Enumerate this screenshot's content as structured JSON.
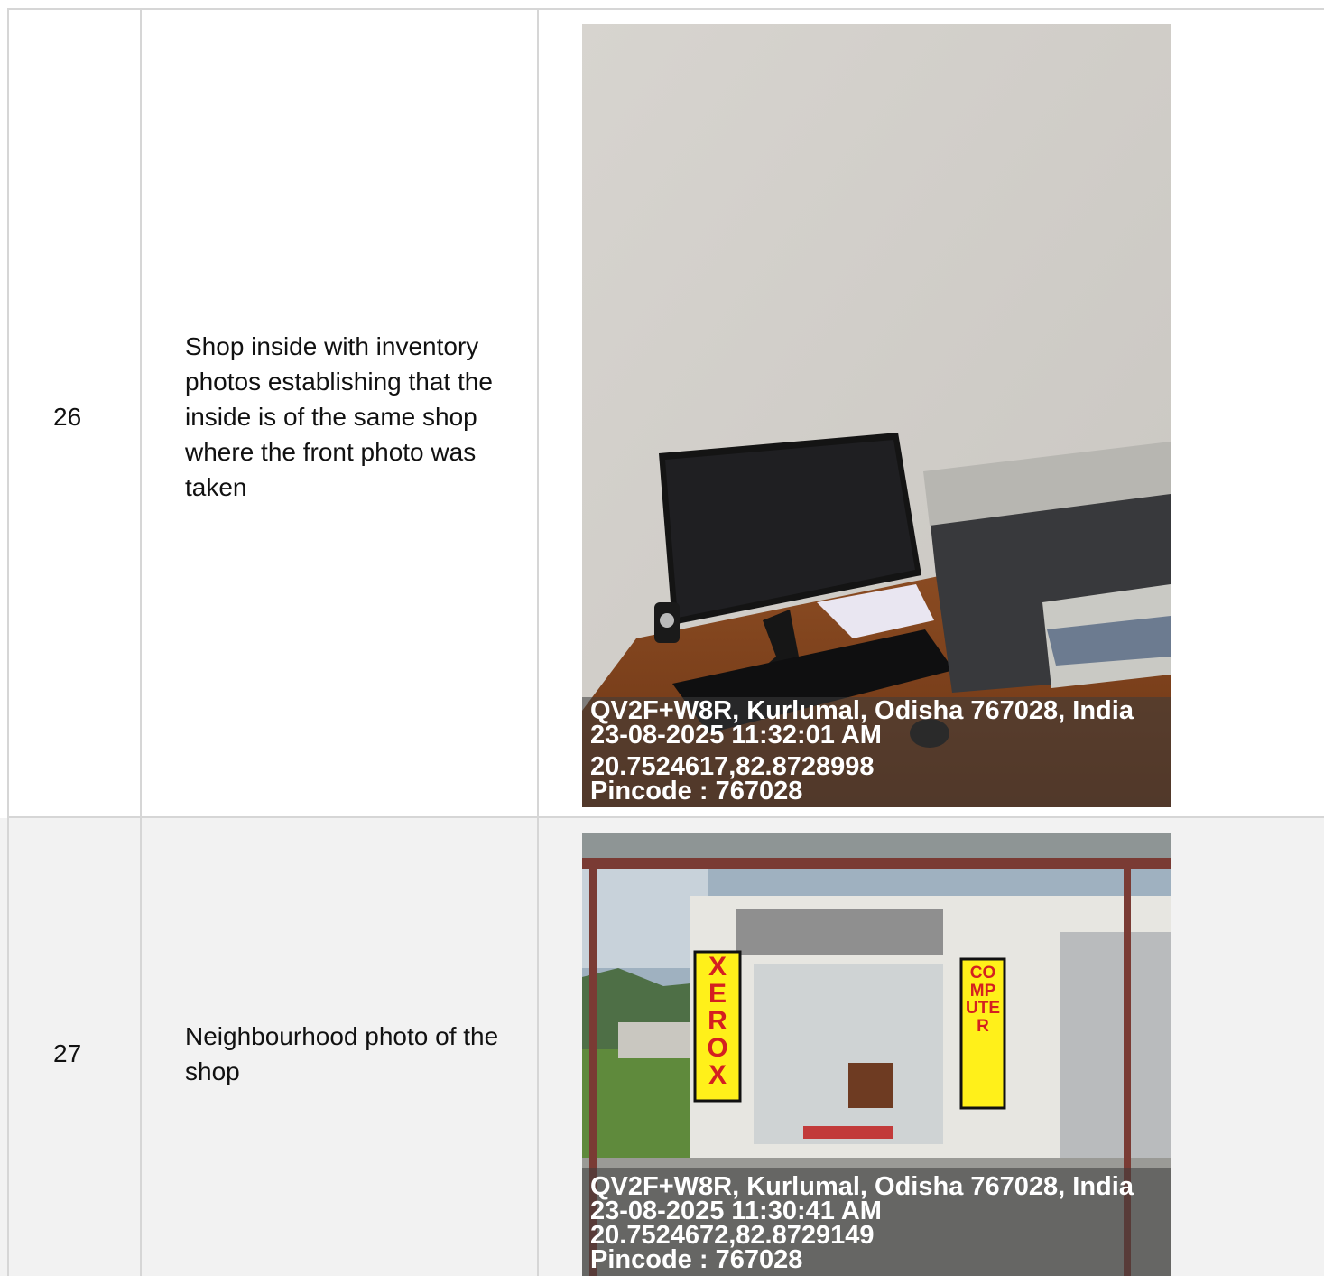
{
  "rows": [
    {
      "index": "26",
      "description": "Shop inside with inventory photos establishing that the inside is of the same shop where the front photo was taken",
      "photo": {
        "subject": "office-desk-monitor-printer",
        "overlay": {
          "address": "QV2F+W8R, Kurlumal, Odisha 767028, India",
          "datetime": "23-08-2025 11:32:01 AM",
          "coords": "20.7524617,82.8728998",
          "pincode": "Pincode : 767028"
        }
      }
    },
    {
      "index": "27",
      "description": "Neighbourhood photo of the shop",
      "photo": {
        "subject": "shop-front-exterior",
        "sign_left": "XEROX",
        "sign_right": "COMPUTER",
        "overlay": {
          "address": "QV2F+W8R, Kurlumal, Odisha 767028, India",
          "datetime": "23-08-2025 11:30:41 AM",
          "coords": "20.7524672,82.8729149",
          "pincode": "Pincode : 767028"
        }
      }
    }
  ]
}
